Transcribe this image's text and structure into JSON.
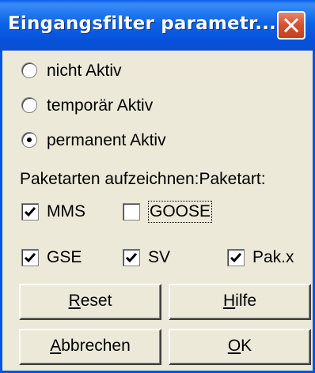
{
  "window": {
    "title": "Eingangsfilter parametr...",
    "close_label": "X"
  },
  "modes": [
    {
      "label": "nicht Aktiv",
      "checked": false
    },
    {
      "label": "temporär Aktiv",
      "checked": false
    },
    {
      "label": "permanent Aktiv",
      "checked": true
    }
  ],
  "section_label": "Paketarten aufzeichnen:Paketart:",
  "packet_types": {
    "mms": {
      "label": "MMS",
      "checked": true
    },
    "goose": {
      "label": "GOOSE",
      "checked": false
    },
    "gse": {
      "label": "GSE",
      "checked": true
    },
    "sv": {
      "label": "SV",
      "checked": true
    },
    "pakx": {
      "label": "Pak.x",
      "checked": true
    }
  },
  "buttons": {
    "reset": {
      "mnemonic": "R",
      "rest": "eset"
    },
    "hilfe": {
      "mnemonic": "H",
      "rest": "ilfe"
    },
    "abbrechen": {
      "mnemonic": "A",
      "rest": "bbrechen"
    },
    "ok": {
      "mnemonic": "O",
      "rest": "K"
    }
  },
  "colors": {
    "title_bar": "#0d64e8",
    "close_button": "#d5502d",
    "dialog_bg": "#ece9d8"
  }
}
